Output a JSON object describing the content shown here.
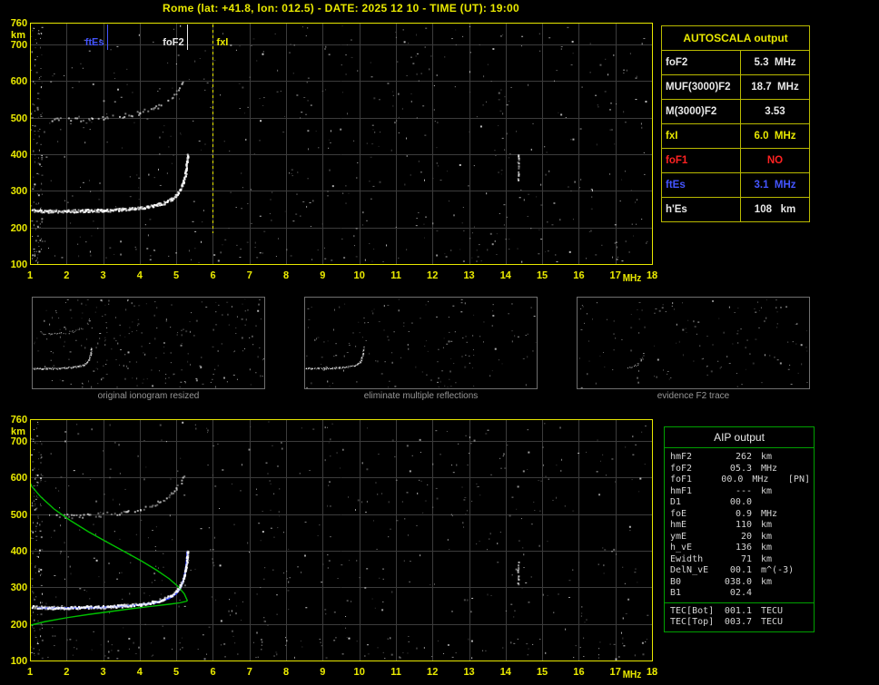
{
  "title": "Rome (lat: +41.8, lon: 012.5) - DATE: 2025 12 10 - TIME (UT): 19:00",
  "colors": {
    "accent_yellow": "#e8e800",
    "grid": "#3c3c3c",
    "blue": "#3344ff",
    "red": "#ff2222",
    "green": "#00c000",
    "table_green": "#00a000",
    "gray_text": "#989898",
    "white": "#e8e8e8"
  },
  "autoscala": {
    "header": "AUTOSCALA output",
    "rows": [
      {
        "label": "foF2",
        "value": "5.3  MHz",
        "color": "white"
      },
      {
        "label": "MUF(3000)F2",
        "value": "18.7  MHz",
        "color": "white"
      },
      {
        "label": "M(3000)F2",
        "value": "3.53",
        "color": "white"
      },
      {
        "label": "fxI",
        "value": "6.0  MHz",
        "color": "yellow"
      },
      {
        "label": "foF1",
        "value": "NO",
        "color": "red"
      },
      {
        "label": "ftEs",
        "value": "3.1  MHz",
        "color": "blue"
      },
      {
        "label": "h'Es",
        "value": "108   km",
        "color": "white"
      }
    ]
  },
  "aip": {
    "header": "AIP output",
    "rows": [
      {
        "label": "hmF2",
        "value": "262",
        "unit": "km",
        "extra": ""
      },
      {
        "label": "foF2",
        "value": "05.3",
        "unit": "MHz",
        "extra": ""
      },
      {
        "label": "foF1",
        "value": "00.0",
        "unit": "MHz",
        "extra": "[PN]"
      },
      {
        "label": "hmF1",
        "value": "---",
        "unit": "km",
        "extra": ""
      },
      {
        "label": "D1",
        "value": "00.0",
        "unit": "",
        "extra": ""
      },
      {
        "label": "foE",
        "value": "0.9",
        "unit": "MHz",
        "extra": ""
      },
      {
        "label": "hmE",
        "value": "110",
        "unit": "km",
        "extra": ""
      },
      {
        "label": "ymE",
        "value": "20",
        "unit": "km",
        "extra": ""
      },
      {
        "label": "h_vE",
        "value": "136",
        "unit": "km",
        "extra": ""
      },
      {
        "label": "Ewidth",
        "value": "71",
        "unit": "km",
        "extra": ""
      },
      {
        "label": "DelN_vE",
        "value": "00.1",
        "unit": "m^(-3)",
        "extra": ""
      },
      {
        "label": "B0",
        "value": "038.0",
        "unit": "km",
        "extra": ""
      },
      {
        "label": "B1",
        "value": "02.4",
        "unit": "",
        "extra": ""
      }
    ],
    "tec_rows": [
      {
        "label": "TEC[Bot]",
        "value": "001.1",
        "unit": "TECU",
        "extra": ""
      },
      {
        "label": "TEC[Top]",
        "value": "003.7",
        "unit": "TECU",
        "extra": ""
      }
    ]
  },
  "thumbnails": [
    {
      "caption": "original ionogram resized"
    },
    {
      "caption": "eliminate multiple reflections"
    },
    {
      "caption": "evidence F2 trace"
    }
  ],
  "chart_data": {
    "type": "scatter",
    "title": "Ionogram - Rome 2025-12-10 19:00 UT",
    "xlabel": "MHz",
    "ylabel": "km",
    "xlim": [
      1,
      18
    ],
    "ylim": [
      100,
      760
    ],
    "x_ticks": [
      1,
      2,
      3,
      4,
      5,
      6,
      7,
      8,
      9,
      10,
      11,
      12,
      13,
      14,
      15,
      16,
      17,
      18
    ],
    "y_ticks": [
      760,
      700,
      600,
      500,
      400,
      300,
      200,
      100
    ],
    "grid": true,
    "markers": [
      {
        "label": "ftEs",
        "f": 3.1,
        "color": "#4455ff",
        "side": "left",
        "len": 28
      },
      {
        "label": "foF2",
        "f": 5.3,
        "color": "#e8e8e8",
        "side": "left",
        "len": 28
      },
      {
        "label": "fxI",
        "f": 6.0,
        "color": "#e8e800",
        "side": "right",
        "len": 230,
        "dash": [
          3,
          3
        ]
      }
    ],
    "traces": {
      "main": [
        [
          1.05,
          248
        ],
        [
          1.5,
          246
        ],
        [
          2.0,
          246
        ],
        [
          2.5,
          247
        ],
        [
          3.0,
          248
        ],
        [
          3.5,
          251
        ],
        [
          4.0,
          255
        ],
        [
          4.35,
          261
        ],
        [
          4.65,
          269
        ],
        [
          4.85,
          279
        ],
        [
          5.0,
          291
        ],
        [
          5.1,
          306
        ],
        [
          5.18,
          326
        ],
        [
          5.24,
          352
        ],
        [
          5.28,
          378
        ],
        [
          5.3,
          400
        ]
      ],
      "second_order": [
        [
          1.6,
          498
        ],
        [
          2.1,
          496
        ],
        [
          2.6,
          498
        ],
        [
          3.1,
          502
        ],
        [
          3.6,
          508
        ],
        [
          4.0,
          516
        ],
        [
          4.35,
          527
        ],
        [
          4.65,
          541
        ],
        [
          4.85,
          556
        ],
        [
          5.0,
          572
        ],
        [
          5.12,
          590
        ],
        [
          5.22,
          612
        ]
      ],
      "restored_blue": [
        [
          1.2,
          243
        ],
        [
          2.0,
          243
        ],
        [
          3.0,
          245
        ],
        [
          3.8,
          250
        ],
        [
          4.4,
          257
        ],
        [
          4.8,
          270
        ],
        [
          5.0,
          283
        ],
        [
          5.12,
          300
        ],
        [
          5.2,
          322
        ],
        [
          5.26,
          350
        ],
        [
          5.29,
          378
        ],
        [
          5.3,
          398
        ]
      ],
      "profile_green": [
        [
          1.0,
          196
        ],
        [
          1.4,
          206
        ],
        [
          2.0,
          217
        ],
        [
          2.6,
          226
        ],
        [
          3.2,
          234
        ],
        [
          3.8,
          242
        ],
        [
          4.3,
          248
        ],
        [
          4.8,
          254
        ],
        [
          5.1,
          258
        ],
        [
          5.28,
          262
        ],
        [
          5.3,
          264
        ],
        [
          5.22,
          282
        ],
        [
          5.05,
          302
        ],
        [
          4.8,
          324
        ],
        [
          4.45,
          348
        ],
        [
          4.05,
          372
        ],
        [
          3.6,
          397
        ],
        [
          3.1,
          424
        ],
        [
          2.6,
          452
        ],
        [
          2.1,
          483
        ],
        [
          1.65,
          515
        ],
        [
          1.3,
          547
        ],
        [
          1.05,
          576
        ],
        [
          0.95,
          598
        ]
      ],
      "evidence": [
        [
          4.7,
          253
        ],
        [
          5.05,
          260
        ],
        [
          5.3,
          270
        ],
        [
          5.5,
          284
        ],
        [
          5.65,
          303
        ],
        [
          5.78,
          330
        ],
        [
          5.85,
          358
        ]
      ]
    },
    "streaks_top": [
      {
        "f": 14.33,
        "h1": 330,
        "h2": 400
      }
    ],
    "streaks_bottom": [
      {
        "f": 14.33,
        "h1": 305,
        "h2": 372
      }
    ],
    "noise": {
      "seed_top": 101,
      "seed_bottom": 202,
      "count": 520,
      "left_edge_count": 130,
      "bottom_count": 70
    }
  }
}
